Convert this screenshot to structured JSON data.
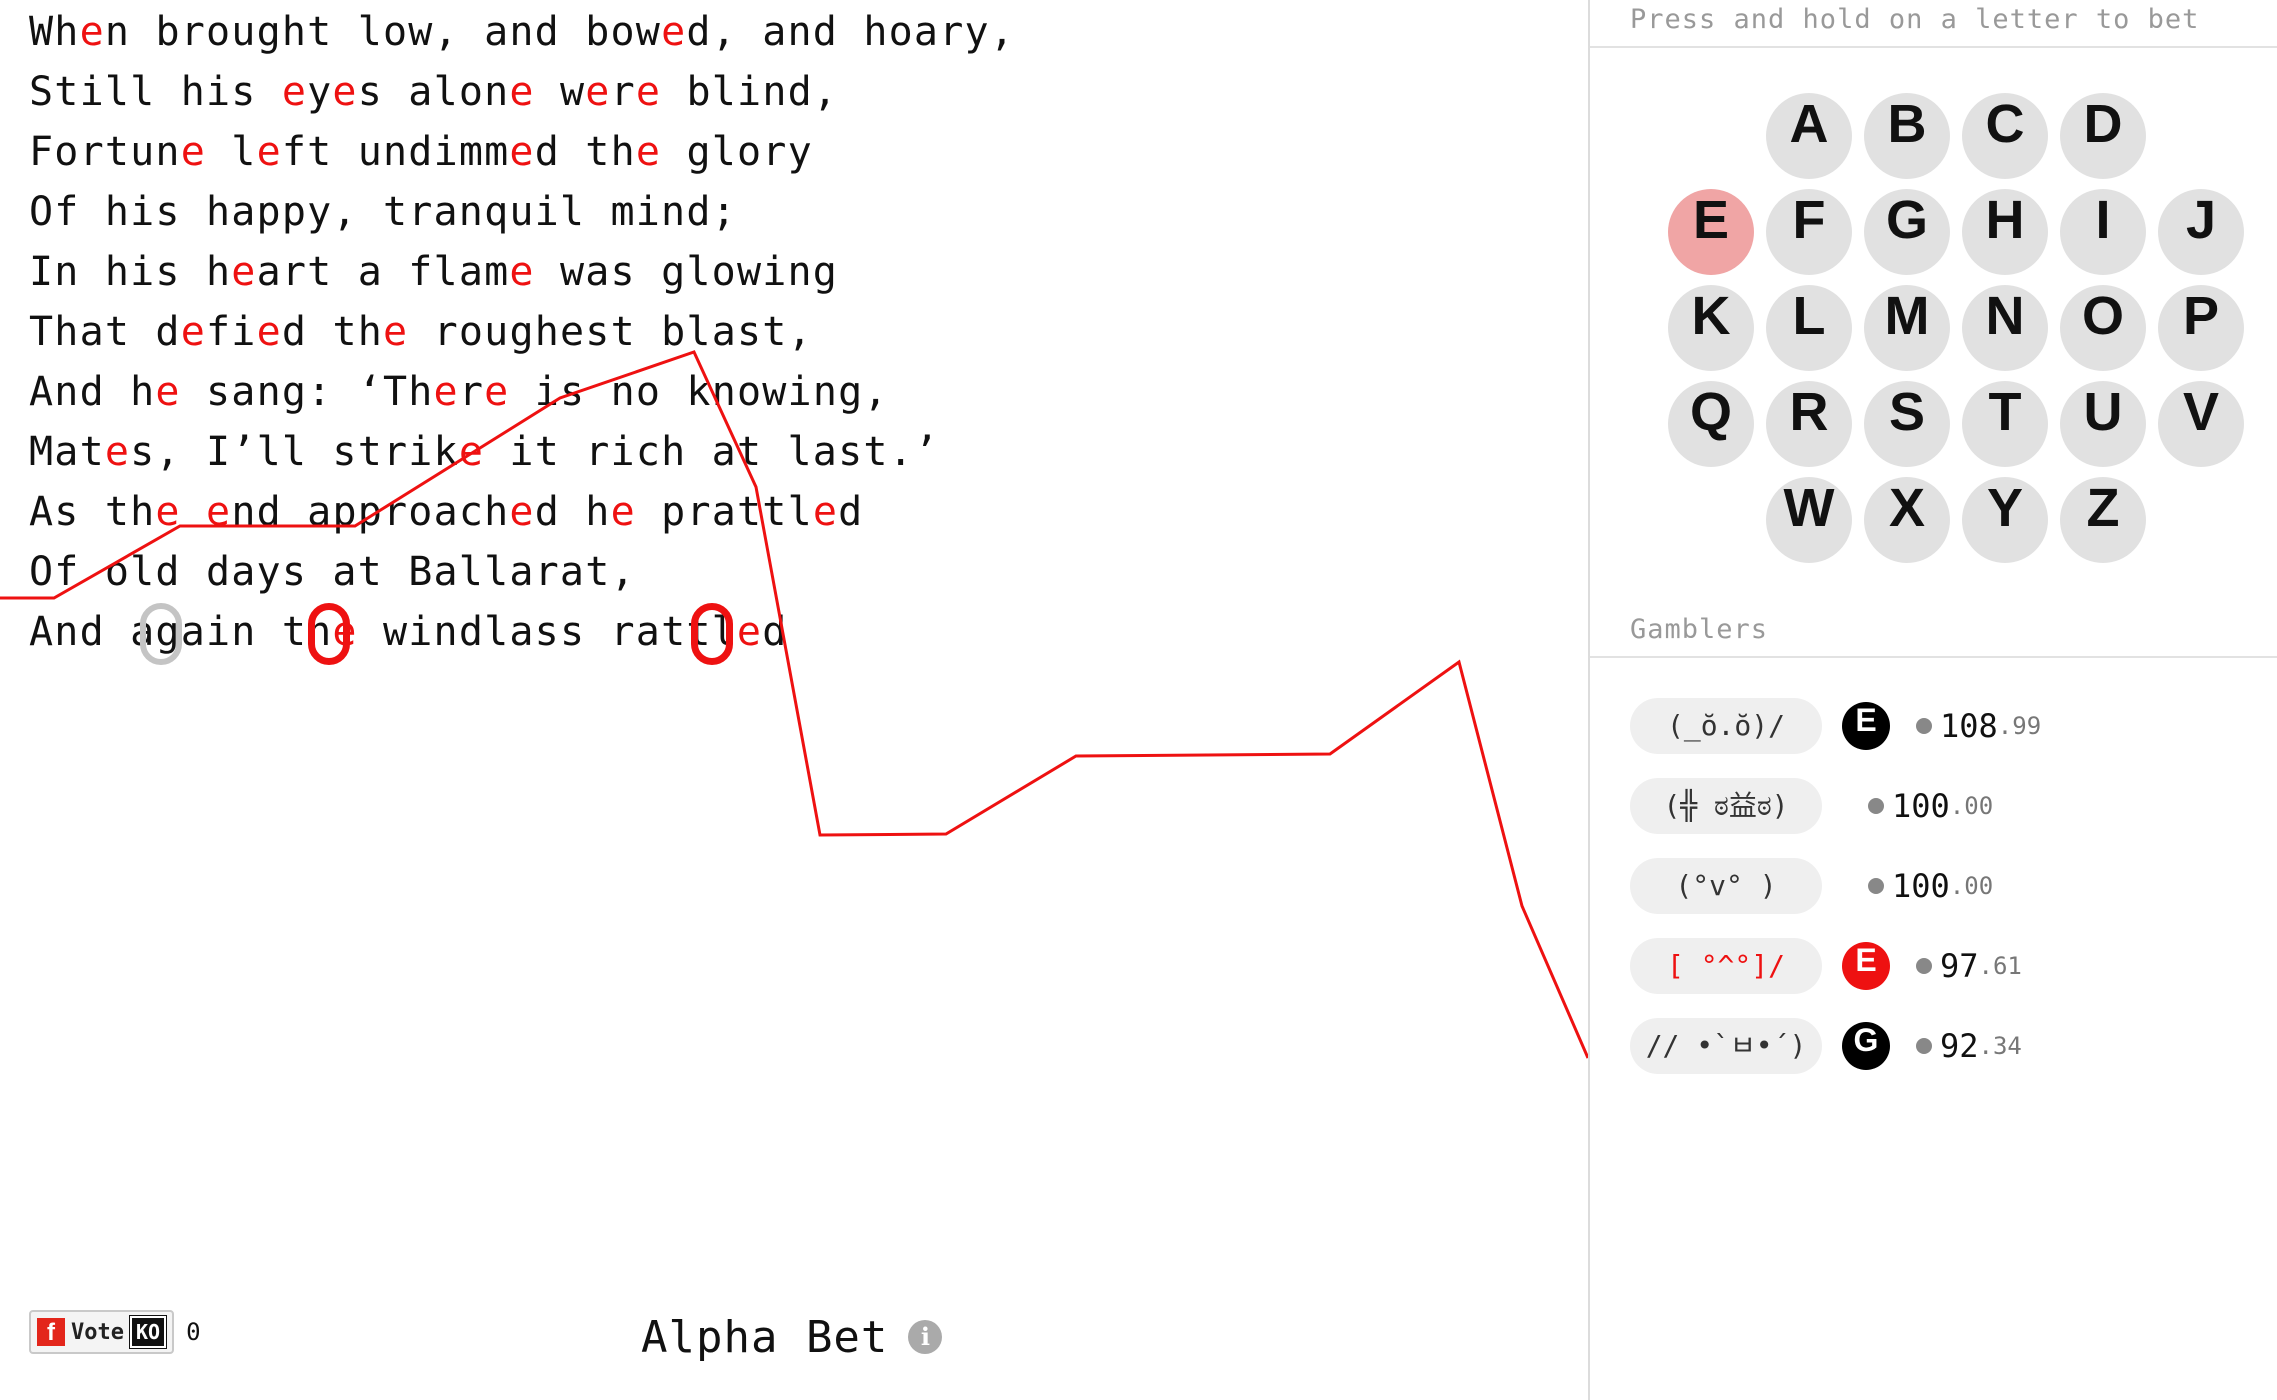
{
  "poem": {
    "lines": [
      [
        [
          "Wh"
        ],
        [
          "e",
          1
        ],
        [
          "n brought low, and bow"
        ],
        [
          "e",
          1
        ],
        [
          "d, and hoary,"
        ]
      ],
      [
        [
          "Still his "
        ],
        [
          "e",
          1
        ],
        [
          "y"
        ],
        [
          "e",
          1
        ],
        [
          "s alon"
        ],
        [
          "e",
          1
        ],
        [
          " w"
        ],
        [
          "e",
          1
        ],
        [
          "r"
        ],
        [
          "e",
          1
        ],
        [
          " blind,"
        ]
      ],
      [
        [
          "Fortun"
        ],
        [
          "e",
          1
        ],
        [
          " l"
        ],
        [
          "e",
          1
        ],
        [
          "ft undimm"
        ],
        [
          "e",
          1
        ],
        [
          "d th"
        ],
        [
          "e",
          1
        ],
        [
          " glory"
        ]
      ],
      [
        [
          "Of his happy, tranquil mind;"
        ]
      ],
      [
        [
          "In his h"
        ],
        [
          "e",
          1
        ],
        [
          "art a flam"
        ],
        [
          "e",
          1
        ],
        [
          " was glowing"
        ]
      ],
      [
        [
          "That d"
        ],
        [
          "e",
          1
        ],
        [
          "fi"
        ],
        [
          "e",
          1
        ],
        [
          "d th"
        ],
        [
          "e",
          1
        ],
        [
          " roughest blast,"
        ]
      ],
      [
        [
          "And h"
        ],
        [
          "e",
          1
        ],
        [
          " sang: ‘Th"
        ],
        [
          "e",
          1
        ],
        [
          "r"
        ],
        [
          "e",
          1
        ],
        [
          " is no knowing,"
        ]
      ],
      [
        [
          "Mat"
        ],
        [
          "e",
          1
        ],
        [
          "s, I’ll strik"
        ],
        [
          "e",
          1
        ],
        [
          " it rich at last.’"
        ]
      ],
      [
        [
          "As th"
        ],
        [
          "e",
          1
        ],
        [
          " "
        ],
        [
          "e",
          1
        ],
        [
          "nd approach"
        ],
        [
          "e",
          1
        ],
        [
          "d h"
        ],
        [
          "e",
          1
        ],
        [
          " prattl"
        ],
        [
          "e",
          1
        ],
        [
          "d"
        ]
      ],
      [
        [
          "Of old days at Ballarat,"
        ]
      ],
      [
        [
          "And again th"
        ],
        [
          "e",
          1
        ],
        [
          " windlass rattl"
        ],
        [
          "e",
          1
        ],
        [
          "d"
        ]
      ]
    ]
  },
  "colors": {
    "highlight": "#ee1111",
    "chart_line": "#ee1111",
    "selected_letter": "#f0a5a5",
    "badge_black": "#000000",
    "badge_red": "#ee1111"
  },
  "footer": {
    "vote_label": "Vote",
    "vote_badge": "KO",
    "vote_icon": "f",
    "vote_count": "0",
    "app_title": "Alpha Bet",
    "info_icon": "i"
  },
  "letters_panel": {
    "prompt": "Press and hold on a letter to bet",
    "selected": "E",
    "rows": [
      [
        "A",
        "B",
        "C",
        "D"
      ],
      [
        "E",
        "F",
        "G",
        "H",
        "I",
        "J"
      ],
      [
        "K",
        "L",
        "M",
        "N",
        "O",
        "P"
      ],
      [
        "Q",
        "R",
        "S",
        "T",
        "U",
        "V"
      ],
      [
        "W",
        "X",
        "Y",
        "Z"
      ]
    ]
  },
  "gamblers": {
    "label": "Gamblers",
    "list": [
      {
        "face": "(_ŏ.ŏ)/",
        "bet": "E",
        "bet_color": "#000000",
        "balance_int": "108",
        "balance_dec": ".99"
      },
      {
        "face": "(╬ ಠ益ಠ)",
        "bet": "",
        "bet_color": "",
        "balance_int": "100",
        "balance_dec": ".00"
      },
      {
        "face": "(°v° )",
        "bet": "",
        "bet_color": "",
        "balance_int": "100",
        "balance_dec": ".00"
      },
      {
        "face": "[ °^°]/",
        "bet": "E",
        "bet_color": "#ee1111",
        "balance_int": "97",
        "balance_dec": ".61",
        "face_color": "#ee1111"
      },
      {
        "face": "// •̀ㅂ•́)",
        "bet": "G",
        "bet_color": "#000000",
        "balance_int": "92",
        "balance_dec": ".34"
      }
    ]
  }
}
